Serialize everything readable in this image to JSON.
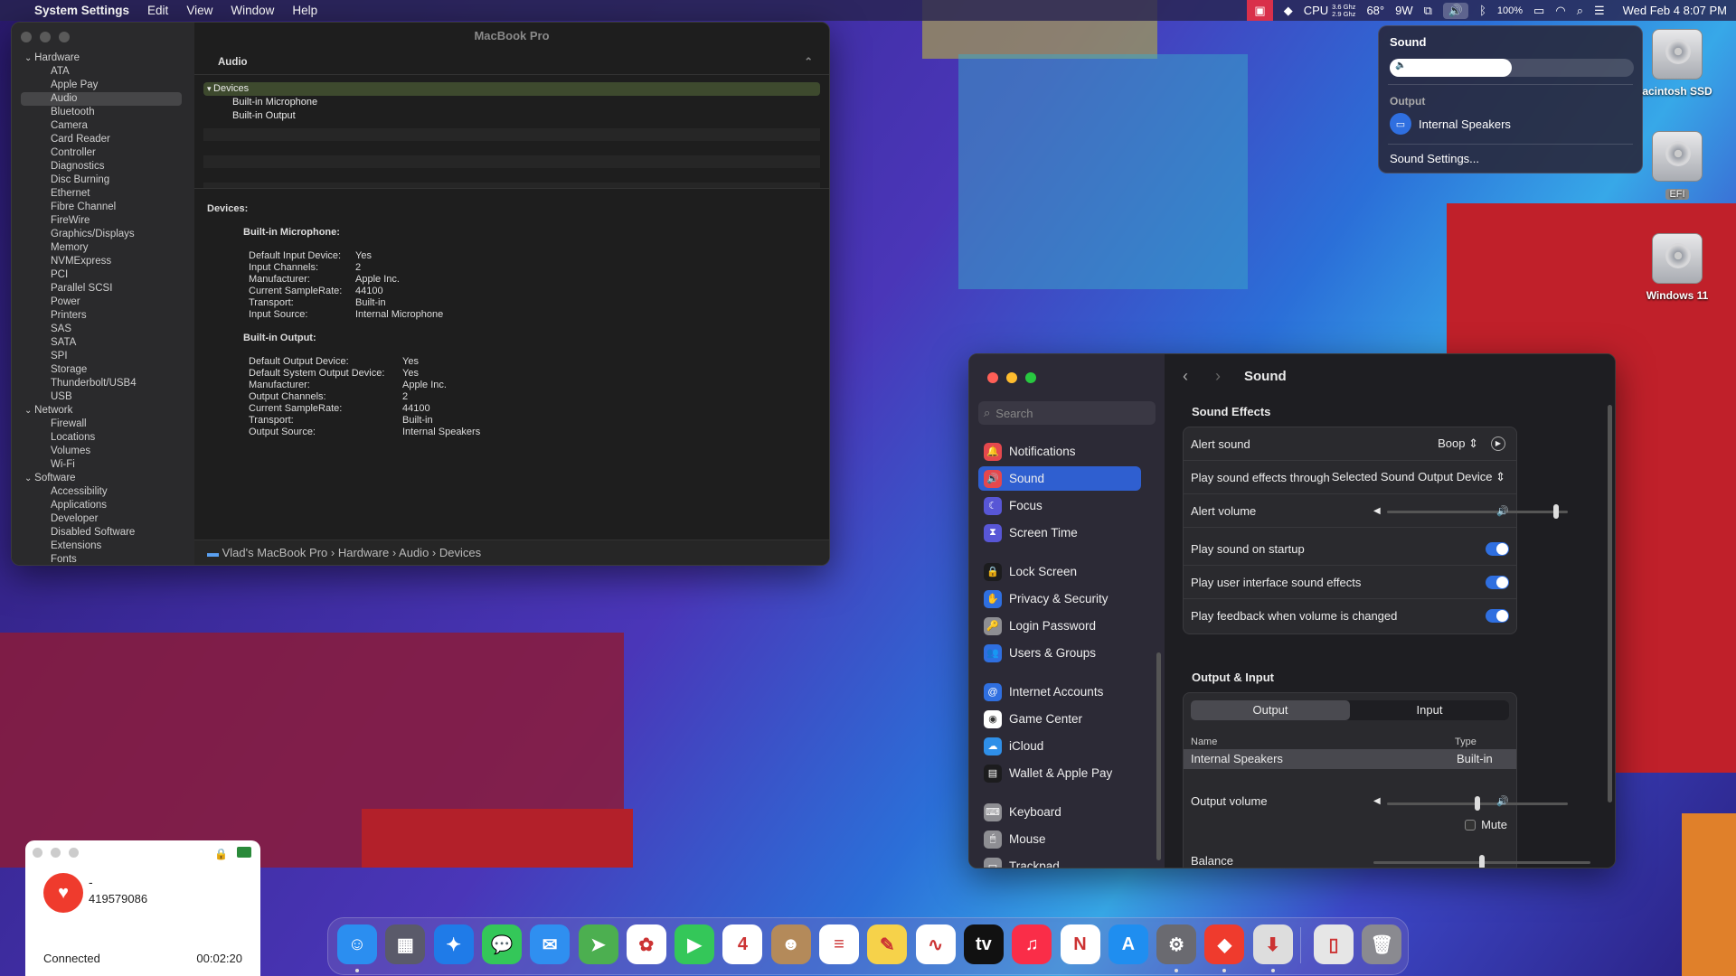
{
  "menubar": {
    "app": "System Settings",
    "items": [
      "Edit",
      "View",
      "Window",
      "Help"
    ],
    "cpu_label": "CPU",
    "cpu_freq1": "3.6 Ghz",
    "cpu_freq2": "2.9 Ghz",
    "temp": "68°",
    "power": "9W",
    "battery": "100%",
    "datetime": "Wed Feb 4  8:07 PM"
  },
  "sound_menu": {
    "title": "Sound",
    "output_label": "Output",
    "device": "Internal Speakers",
    "settings": "Sound Settings...",
    "volume": 0.5
  },
  "desktop_icons": [
    {
      "label": "acintosh SSD"
    },
    {
      "label": "EFI"
    },
    {
      "label": "Windows 11"
    }
  ],
  "sysinfo": {
    "window_title": "MacBook Pro",
    "header": "Audio",
    "sidebar": [
      {
        "label": "Hardware",
        "type": "grp"
      },
      {
        "label": "ATA"
      },
      {
        "label": "Apple Pay"
      },
      {
        "label": "Audio",
        "sel": true
      },
      {
        "label": "Bluetooth"
      },
      {
        "label": "Camera"
      },
      {
        "label": "Card Reader"
      },
      {
        "label": "Controller"
      },
      {
        "label": "Diagnostics"
      },
      {
        "label": "Disc Burning"
      },
      {
        "label": "Ethernet"
      },
      {
        "label": "Fibre Channel"
      },
      {
        "label": "FireWire"
      },
      {
        "label": "Graphics/Displays"
      },
      {
        "label": "Memory"
      },
      {
        "label": "NVMExpress"
      },
      {
        "label": "PCI"
      },
      {
        "label": "Parallel SCSI"
      },
      {
        "label": "Power"
      },
      {
        "label": "Printers"
      },
      {
        "label": "SAS"
      },
      {
        "label": "SATA"
      },
      {
        "label": "SPI"
      },
      {
        "label": "Storage"
      },
      {
        "label": "Thunderbolt/USB4"
      },
      {
        "label": "USB"
      },
      {
        "label": "Network",
        "type": "grp"
      },
      {
        "label": "Firewall"
      },
      {
        "label": "Locations"
      },
      {
        "label": "Volumes"
      },
      {
        "label": "Wi-Fi"
      },
      {
        "label": "Software",
        "type": "grp"
      },
      {
        "label": "Accessibility"
      },
      {
        "label": "Applications"
      },
      {
        "label": "Developer"
      },
      {
        "label": "Disabled Software"
      },
      {
        "label": "Extensions"
      },
      {
        "label": "Fonts"
      }
    ],
    "tree": {
      "root": "Devices",
      "children": [
        "Built-in Microphone",
        "Built-in Output"
      ]
    },
    "detail": {
      "heading": "Devices:",
      "mic_title": "Built-in Microphone:",
      "mic": [
        [
          "Default Input Device:",
          "Yes"
        ],
        [
          "Input Channels:",
          "2"
        ],
        [
          "Manufacturer:",
          "Apple Inc."
        ],
        [
          "Current SampleRate:",
          "44100"
        ],
        [
          "Transport:",
          "Built-in"
        ],
        [
          "Input Source:",
          "Internal Microphone"
        ]
      ],
      "out_title": "Built-in Output:",
      "out": [
        [
          "Default Output Device:",
          "Yes"
        ],
        [
          "Default System Output Device:",
          "Yes"
        ],
        [
          "Manufacturer:",
          "Apple Inc."
        ],
        [
          "Output Channels:",
          "2"
        ],
        [
          "Current SampleRate:",
          "44100"
        ],
        [
          "Transport:",
          "Built-in"
        ],
        [
          "Output Source:",
          "Internal Speakers"
        ]
      ]
    },
    "path": [
      "Vlad's MacBook Pro",
      "Hardware",
      "Audio",
      "Devices"
    ]
  },
  "settings": {
    "title": "Sound",
    "search_placeholder": "Search",
    "sidebar": [
      {
        "label": "Notifications",
        "color": "#e5484d",
        "g": "🔔"
      },
      {
        "label": "Sound",
        "color": "#e5484d",
        "g": "🔊",
        "sel": true
      },
      {
        "label": "Focus",
        "color": "#5856d6",
        "g": "☾"
      },
      {
        "label": "Screen Time",
        "color": "#5856d6",
        "g": "⧗"
      },
      {
        "label": "Lock Screen",
        "color": "#1c1c1e",
        "g": "🔒",
        "gap": true
      },
      {
        "label": "Privacy & Security",
        "color": "#2f6fe0",
        "g": "✋"
      },
      {
        "label": "Login Password",
        "color": "#8e8e93",
        "g": "🔑"
      },
      {
        "label": "Users & Groups",
        "color": "#2f6fe0",
        "g": "👥"
      },
      {
        "label": "Internet Accounts",
        "color": "#2f6fe0",
        "g": "@",
        "gap": true
      },
      {
        "label": "Game Center",
        "color": "#ffffff",
        "g": "◉"
      },
      {
        "label": "iCloud",
        "color": "#2f8fe8",
        "g": "☁"
      },
      {
        "label": "Wallet & Apple Pay",
        "color": "#1c1c1e",
        "g": "▤"
      },
      {
        "label": "Keyboard",
        "color": "#8e8e93",
        "g": "⌨",
        "gap": true
      },
      {
        "label": "Mouse",
        "color": "#8e8e93",
        "g": "🖱"
      },
      {
        "label": "Trackpad",
        "color": "#8e8e93",
        "g": "▭"
      }
    ],
    "effects_heading": "Sound Effects",
    "alert_sound_label": "Alert sound",
    "alert_sound_value": "Boop",
    "through_label": "Play sound effects through",
    "through_value": "Selected Sound Output Device",
    "alert_volume_label": "Alert volume",
    "alert_volume": 0.95,
    "startup_label": "Play sound on startup",
    "ui_label": "Play user interface sound effects",
    "feedback_label": "Play feedback when volume is changed",
    "oi_heading": "Output & Input",
    "tab_output": "Output",
    "tab_input": "Input",
    "col_name": "Name",
    "col_type": "Type",
    "row_name": "Internal Speakers",
    "row_type": "Built-in",
    "output_volume_label": "Output volume",
    "output_volume": 0.5,
    "mute_label": "Mute",
    "balance_label": "Balance",
    "balance": 0.5
  },
  "anydesk": {
    "name": "-",
    "id": "419579086",
    "status": "Connected",
    "time": "00:02:20"
  },
  "dock": [
    {
      "n": "finder",
      "c": "#2b8ef0",
      "g": "☺",
      "dot": true
    },
    {
      "n": "launchpad",
      "c": "#5a5a6a",
      "g": "▦"
    },
    {
      "n": "safari",
      "c": "#1f7be8",
      "g": "✦"
    },
    {
      "n": "messages",
      "c": "#34c759",
      "g": "💬"
    },
    {
      "n": "mail",
      "c": "#2f8ff0",
      "g": "✉"
    },
    {
      "n": "maps",
      "c": "#4caf50",
      "g": "➤"
    },
    {
      "n": "photos",
      "c": "#ffffff",
      "g": "✿"
    },
    {
      "n": "facetime",
      "c": "#34c759",
      "g": "▶"
    },
    {
      "n": "calendar",
      "c": "#ffffff",
      "g": "4"
    },
    {
      "n": "contacts",
      "c": "#b48a5a",
      "g": "☻"
    },
    {
      "n": "reminders",
      "c": "#ffffff",
      "g": "≡"
    },
    {
      "n": "notes",
      "c": "#f6d24a",
      "g": "✎"
    },
    {
      "n": "freeform",
      "c": "#ffffff",
      "g": "∿"
    },
    {
      "n": "tv",
      "c": "#111111",
      "g": "tv"
    },
    {
      "n": "music",
      "c": "#fa2d48",
      "g": "♫"
    },
    {
      "n": "news",
      "c": "#ffffff",
      "g": "N"
    },
    {
      "n": "app-store",
      "c": "#1f8ef0",
      "g": "A"
    },
    {
      "n": "system-settings",
      "c": "#6a6a70",
      "g": "⚙",
      "dot": true
    },
    {
      "n": "anydesk",
      "c": "#ef3b2d",
      "g": "◆",
      "dot": true
    },
    {
      "n": "installer",
      "c": "#dddddd",
      "g": "⬇",
      "dot": true
    },
    {
      "n": "documents",
      "c": "#e6e6e6",
      "g": "▯"
    },
    {
      "n": "trash",
      "c": "#8a8a90",
      "g": "🗑"
    }
  ]
}
